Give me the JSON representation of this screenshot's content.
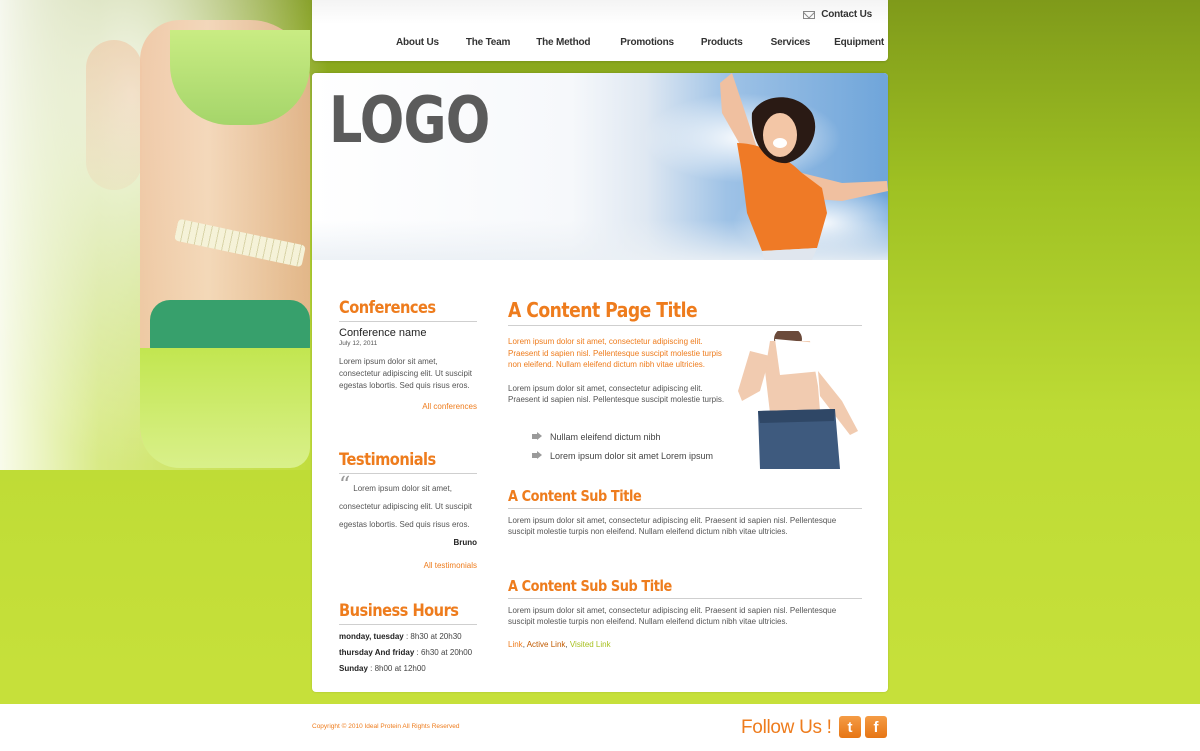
{
  "header": {
    "contact_label": "Contact Us",
    "nav": [
      "About Us",
      "The Team",
      "The Method",
      "Promotions",
      "Products",
      "Services",
      "Equipment"
    ]
  },
  "banner": {
    "logo": "LOGO"
  },
  "sidebar": {
    "conferences": {
      "title": "Conferences",
      "name": "Conference name",
      "date": "July 12, 2011",
      "text": "Lorem ipsum dolor sit amet, consectetur adipiscing elit. Ut suscipit egestas lobortis. Sed quis risus eros.",
      "link": "All conferences"
    },
    "testimonials": {
      "title": "Testimonials",
      "quote": "Lorem ipsum dolor sit amet, consectetur adipiscing elit. Ut suscipit egestas lobortis. Sed quis risus eros.",
      "author": "Bruno",
      "link": "All testimonials"
    },
    "hours": {
      "title": "Business Hours",
      "rows": [
        {
          "days": "monday, tuesday",
          "time": " : 8h30 at 20h30"
        },
        {
          "days": "thursday And friday",
          "time": " : 6h30 at 20h00"
        },
        {
          "days": "Sunday",
          "time": " : 8h00 at 12h00"
        }
      ]
    }
  },
  "content": {
    "title": "A Content Page Title",
    "intro": "Lorem ipsum dolor sit amet, consectetur adipiscing elit. Praesent id sapien nisl. Pellentesque suscipit molestie turpis non eleifend. Nullam eleifend dictum nibh vitae ultricies.",
    "para1": "Lorem ipsum dolor sit amet, consectetur adipiscing elit. Praesent id sapien nisl. Pellentesque suscipit molestie turpis.",
    "bullets": [
      "Nullam eleifend dictum nibh",
      "Lorem ipsum dolor sit amet Lorem ipsum"
    ],
    "sub_title": "A Content Sub Title",
    "sub_text": "Lorem ipsum dolor sit amet, consectetur adipiscing elit. Praesent id sapien nisl. Pellentesque suscipit molestie turpis non eleifend. Nullam eleifend dictum nibh vitae ultricies.",
    "subsub_title": "A Content Sub Sub Title",
    "subsub_text": "Lorem ipsum dolor sit amet, consectetur adipiscing elit. Praesent id sapien nisl. Pellentesque suscipit molestie turpis non eleifend. Nullam eleifend dictum nibh vitae ultricies.",
    "links": {
      "link": "Link",
      "active": "Active Link",
      "visited": "Visited Link",
      "sep": ", "
    }
  },
  "footer": {
    "copyright": "Copyright © 2010 Ideal Protein All Rights Reserved",
    "follow": "Follow Us !",
    "twitter_glyph": "t",
    "facebook_glyph": "f"
  },
  "colors": {
    "accent": "#ee7c1d",
    "link_active": "#c05a00",
    "link_visited": "#a8c020",
    "background_green": "#c6e03a"
  }
}
